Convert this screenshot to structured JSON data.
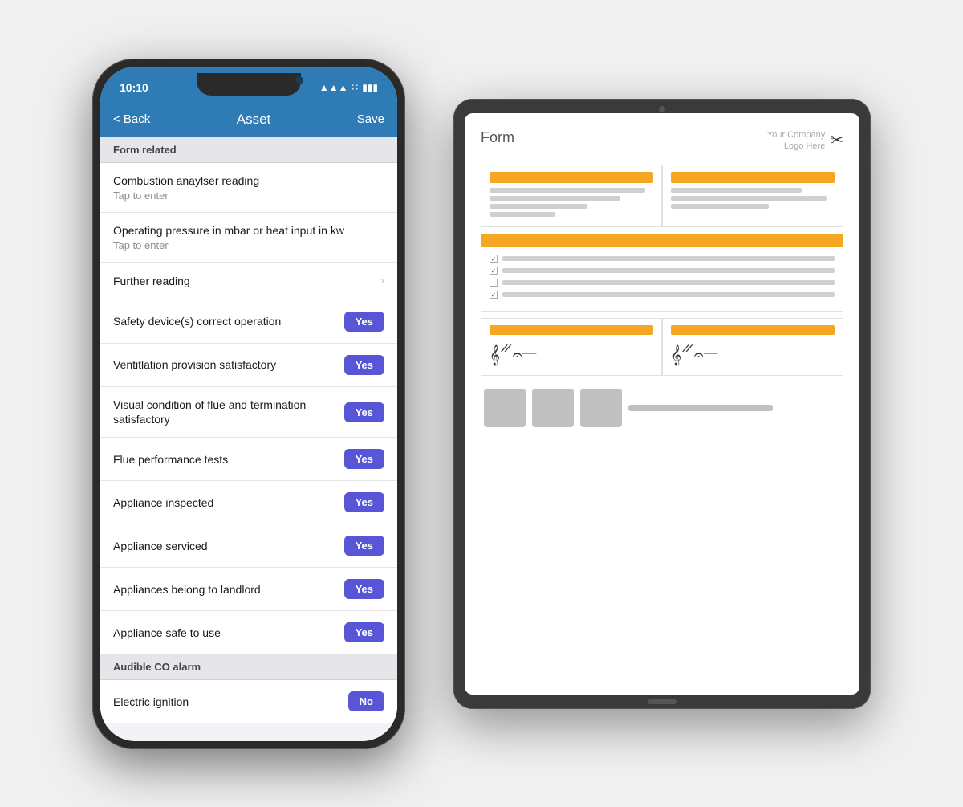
{
  "phone": {
    "status": {
      "time": "10:10",
      "signal": "▲▲▲",
      "wifi": "WiFi",
      "battery": "🔋"
    },
    "nav": {
      "back_label": "< Back",
      "title": "Asset",
      "save_label": "Save"
    },
    "sections": [
      {
        "id": "form-related",
        "header": "Form related",
        "items": [
          {
            "id": "combustion",
            "label": "Combustion anaylser reading",
            "sub": "Tap to enter",
            "badge": null,
            "chevron": false
          },
          {
            "id": "operating-pressure",
            "label": "Operating pressure in mbar or heat input in kw",
            "sub": "Tap to enter",
            "badge": null,
            "chevron": false
          },
          {
            "id": "further-reading",
            "label": "Further reading",
            "sub": null,
            "badge": null,
            "chevron": true
          },
          {
            "id": "safety-devices",
            "label": "Safety device(s) correct operation",
            "sub": null,
            "badge": "Yes",
            "chevron": false
          },
          {
            "id": "ventilation",
            "label": "Ventitlation provision satisfactory",
            "sub": null,
            "badge": "Yes",
            "chevron": false
          },
          {
            "id": "visual-condition",
            "label": "Visual condition of flue and termination satisfactory",
            "sub": null,
            "badge": "Yes",
            "chevron": false
          },
          {
            "id": "flue-performance",
            "label": "Flue performance tests",
            "sub": null,
            "badge": "Yes",
            "chevron": false
          },
          {
            "id": "appliance-inspected",
            "label": "Appliance inspected",
            "sub": null,
            "badge": "Yes",
            "chevron": false
          },
          {
            "id": "appliance-serviced",
            "label": "Appliance serviced",
            "sub": null,
            "badge": "Yes",
            "chevron": false
          },
          {
            "id": "appliances-landlord",
            "label": "Appliances belong to landlord",
            "sub": null,
            "badge": "Yes",
            "chevron": false
          },
          {
            "id": "appliance-safe",
            "label": "Appliance safe to use",
            "sub": null,
            "badge": "Yes",
            "chevron": false
          }
        ]
      },
      {
        "id": "audible-co",
        "header": "Audible CO alarm",
        "items": [
          {
            "id": "electric-ignition",
            "label": "Electric ignition",
            "sub": null,
            "badge": "No",
            "chevron": false
          }
        ]
      }
    ]
  },
  "tablet": {
    "doc_title": "Form",
    "logo_line1": "Your Company",
    "logo_line2": "Logo Here",
    "checkboxes": [
      {
        "checked": true
      },
      {
        "checked": true
      },
      {
        "checked": false
      },
      {
        "checked": true
      }
    ]
  }
}
